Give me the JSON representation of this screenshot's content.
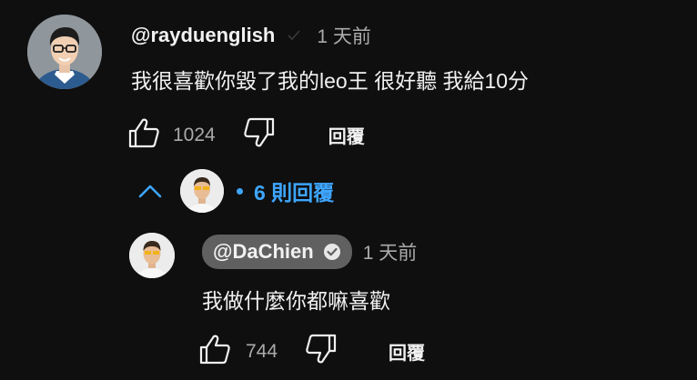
{
  "comment": {
    "author": "@rayduenglish",
    "time": "1 天前",
    "text": "我很喜歡你毀了我的leo王 很好聽 我給10分",
    "like_count": "1024",
    "reply_label": "回覆"
  },
  "replies_toggle": {
    "label": "6 則回覆"
  },
  "reply": {
    "author": "@DaChien",
    "time": "1 天前",
    "text": "我做什麼你都嘛喜歡",
    "like_count": "744",
    "reply_label": "回覆"
  },
  "colors": {
    "background": "#0f0f0f",
    "accent_blue": "#3ea6ff",
    "secondary_text": "#aaaaaa",
    "owner_chip": "#606060"
  },
  "icons": [
    "like-icon",
    "dislike-icon",
    "chevron-up-icon",
    "verified-icon",
    "check-icon"
  ]
}
